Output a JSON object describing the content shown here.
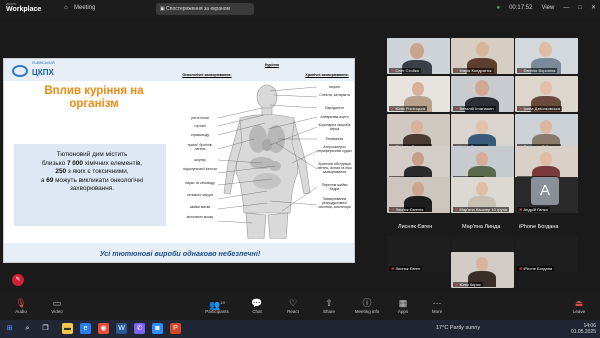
{
  "app": {
    "brand_top": "zoom",
    "brand_bottom": "Workplace",
    "meeting_label": "Meeting",
    "share_banner": "Спостереження за екраном",
    "timer": "00:17:52",
    "view_label": "View"
  },
  "slide": {
    "logo_small": "ЛЬВІВСЬКИЙ",
    "logo_big": "ЦКПХ",
    "title": "Вплив куріння на організм",
    "body_line1": "Тютюновий дим містить",
    "body_line2_pre": "близько ",
    "body_line2_bold": "7 000",
    "body_line2_post": " хімічних елементів,",
    "body_line3_bold": "250",
    "body_line3_post": " з яких є токсичними,",
    "body_line4_pre": "а ",
    "body_line4_bold": "69",
    "body_line4_post": " можуть викликати онкологічні",
    "body_line5": "захворювання.",
    "footer": "Усі тютюнові вироби однаково небезпечні!",
    "diagram": {
      "title": "Куріння",
      "left_head": "Онкологічні захворювання:",
      "right_head": "Хронічні захворювання:",
      "left_labels": [
        "ротоглотки",
        "гортані",
        "стравоходу",
        "трахеї, бронхів, легень",
        "шлунку",
        "підшлункової залози",
        "нирки та сечоводу",
        "сечового міхура",
        "шийки матки",
        "кісткового мозку"
      ],
      "right_labels": [
        "Інсульт",
        "Сліпота, катаракта",
        "Пародонтит",
        "Аневризма аорти",
        "Коронарна хвороба серця",
        "Пневмонія",
        "Атеросклероз периферичних судин",
        "Хронічна обструкція легень, астма та інші захворювання",
        "Перелом шийки бедра",
        "Захворювання репродуктивної системи, імпотенція"
      ]
    }
  },
  "participants": [
    {
      "name": "Олег Стойка",
      "muted": true
    },
    {
      "name": "Марія Кондратюк",
      "muted": true
    },
    {
      "name": "Євгенія Вороніна",
      "muted": true
    },
    {
      "name": "Юлія Ростицька",
      "muted": true
    },
    {
      "name": "Виталій Ігнатишин",
      "muted": true
    },
    {
      "name": "Ірина Дзвонковська",
      "muted": true
    },
    {
      "name": "Вікторія Лозинська",
      "muted": true
    },
    {
      "name": "Ірина Ступнюк",
      "muted": true
    },
    {
      "name": "Людмила Гайдучок",
      "muted": true
    },
    {
      "name": "Лілія Стецько",
      "muted": true
    },
    {
      "name": "Ірина Лелик",
      "muted": true
    },
    {
      "name": "Юлія Кричевська",
      "muted": true
    },
    {
      "name": "Лисняк Євгенія",
      "muted": true
    },
    {
      "name": "Марʼяна Кашпер 10 група",
      "muted": true
    },
    {
      "name": "Андрій Галка",
      "muted": true
    },
    {
      "name": "Лисняк Євген",
      "muted": false,
      "big": true
    },
    {
      "name": "Мар'яна Линда",
      "muted": false,
      "big": true
    },
    {
      "name": "iPhone Богдана",
      "muted": false,
      "big": true
    },
    {
      "name": "Юлія Кирис",
      "muted": true
    }
  ],
  "toolbar": {
    "audio": "Audio",
    "video": "Video",
    "participants": "Participants",
    "participants_count": "19",
    "chat": "Chat",
    "react": "React",
    "share": "Share",
    "meeting_info": "Meeting info",
    "apps": "Apps",
    "more": "More",
    "leave": "Leave"
  },
  "taskbar": {
    "weather": "17°C  Partly sunny",
    "time": "14:06",
    "date": "01.05.2025"
  }
}
